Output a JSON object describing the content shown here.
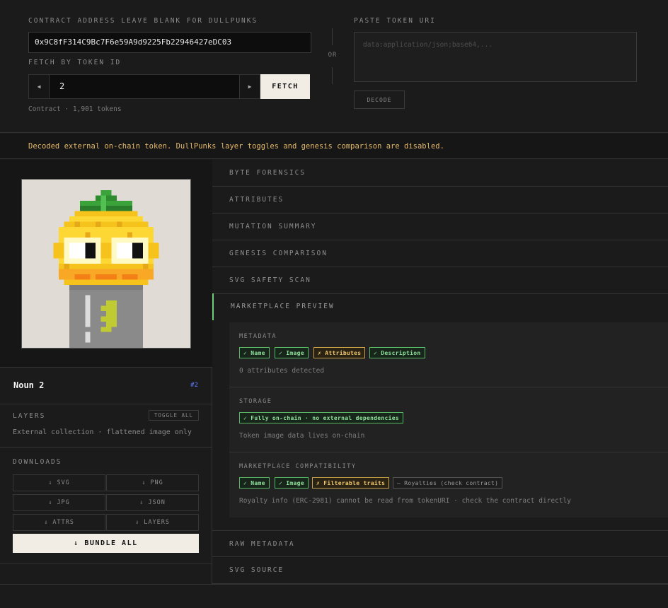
{
  "form": {
    "contract_label": "CONTRACT ADDRESS  LEAVE BLANK FOR DULLPUNKS",
    "contract_value": "0x9C8fF314C9Bc7F6e59A9d9225Fb22946427eDC03",
    "fetch_label": "FETCH BY TOKEN ID",
    "prev_glyph": "◀",
    "next_glyph": "▶",
    "token_id": "2",
    "fetch_button": "FETCH",
    "contract_info": "Contract · 1,901 tokens",
    "or_text": "OR",
    "uri_label": "PASTE TOKEN URI",
    "uri_placeholder": "data:application/json;base64,...",
    "decode_button": "DECODE"
  },
  "notice": "Decoded external on-chain token. DullPunks layer toggles and genesis comparison are disabled.",
  "token": {
    "name": "Noun 2",
    "badge": "#2"
  },
  "layers": {
    "label": "LAYERS",
    "toggle_all": "TOGGLE ALL",
    "note": "External collection · flattened image only"
  },
  "downloads": {
    "label": "DOWNLOADS",
    "svg": "⇓ SVG",
    "png": "⇓ PNG",
    "jpg": "⇓ JPG",
    "json": "⇓ JSON",
    "attrs": "⇓ ATTRS",
    "layers": "⇓ LAYERS",
    "bundle": "⇓ BUNDLE ALL"
  },
  "panels": {
    "byte_forensics": "BYTE FORENSICS",
    "attributes": "ATTRIBUTES",
    "mutation_summary": "MUTATION SUMMARY",
    "genesis_comparison": "GENESIS COMPARISON",
    "svg_safety_scan": "SVG SAFETY SCAN",
    "marketplace_preview": "MARKETPLACE PREVIEW",
    "raw_metadata": "RAW METADATA",
    "svg_source": "SVG SOURCE"
  },
  "preview": {
    "metadata": {
      "label": "METADATA",
      "chips": [
        "✓ Name",
        "✓ Image",
        "✗ Attributes",
        "✓ Description"
      ],
      "note": "0 attributes detected"
    },
    "storage": {
      "label": "STORAGE",
      "chip": "✓ Fully on-chain · no external dependencies",
      "note": "Token image data lives on-chain"
    },
    "compat": {
      "label": "MARKETPLACE COMPATIBILITY",
      "chips": [
        "✓ Name",
        "✓ Image",
        "✗ Filterable traits",
        "– Royalties (check contract)"
      ],
      "note": "Royalty info (ERC-2981) cannot be read from tokenURI · check the contract directly"
    }
  },
  "colors": {
    "accent_ok": "#58b865",
    "accent_warn": "#c9a04a",
    "notice": "#e5b96a",
    "badge": "#5a7dff",
    "art_background": "#e1dbd6"
  }
}
